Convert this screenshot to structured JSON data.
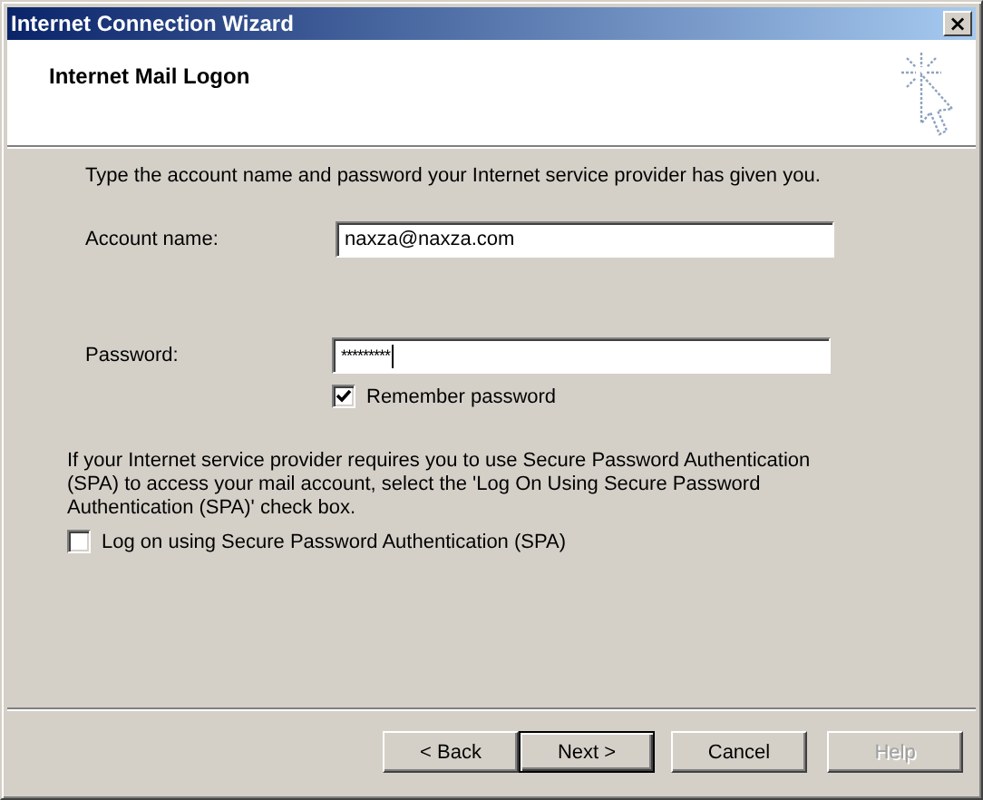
{
  "window": {
    "title": "Internet Connection Wizard",
    "close_label": "×"
  },
  "header": {
    "title": "Internet Mail Logon"
  },
  "intro": "Type the account name and password your Internet service provider has given you.",
  "fields": [
    {
      "kind": "text",
      "label": "Account name:",
      "value": "naxza@naxza.com",
      "focused": false
    },
    {
      "kind": "password",
      "label": "Password:",
      "value": "*********",
      "focused": true
    }
  ],
  "remember": {
    "label": "Remember password",
    "checked": true
  },
  "spa_note": "If your Internet service provider requires you to use Secure Password Authentication (SPA) to access your mail account, select the 'Log On Using Secure Password Authentication (SPA)' check box.",
  "spa": {
    "label": "Log on using Secure Password Authentication (SPA)",
    "checked": false
  },
  "buttons": [
    {
      "label": "< Back",
      "default": false,
      "disabled": false
    },
    {
      "label": "Next >",
      "default": true,
      "disabled": false
    },
    {
      "label": "Cancel",
      "default": false,
      "disabled": false
    },
    {
      "label": "Help",
      "default": false,
      "disabled": true
    }
  ]
}
